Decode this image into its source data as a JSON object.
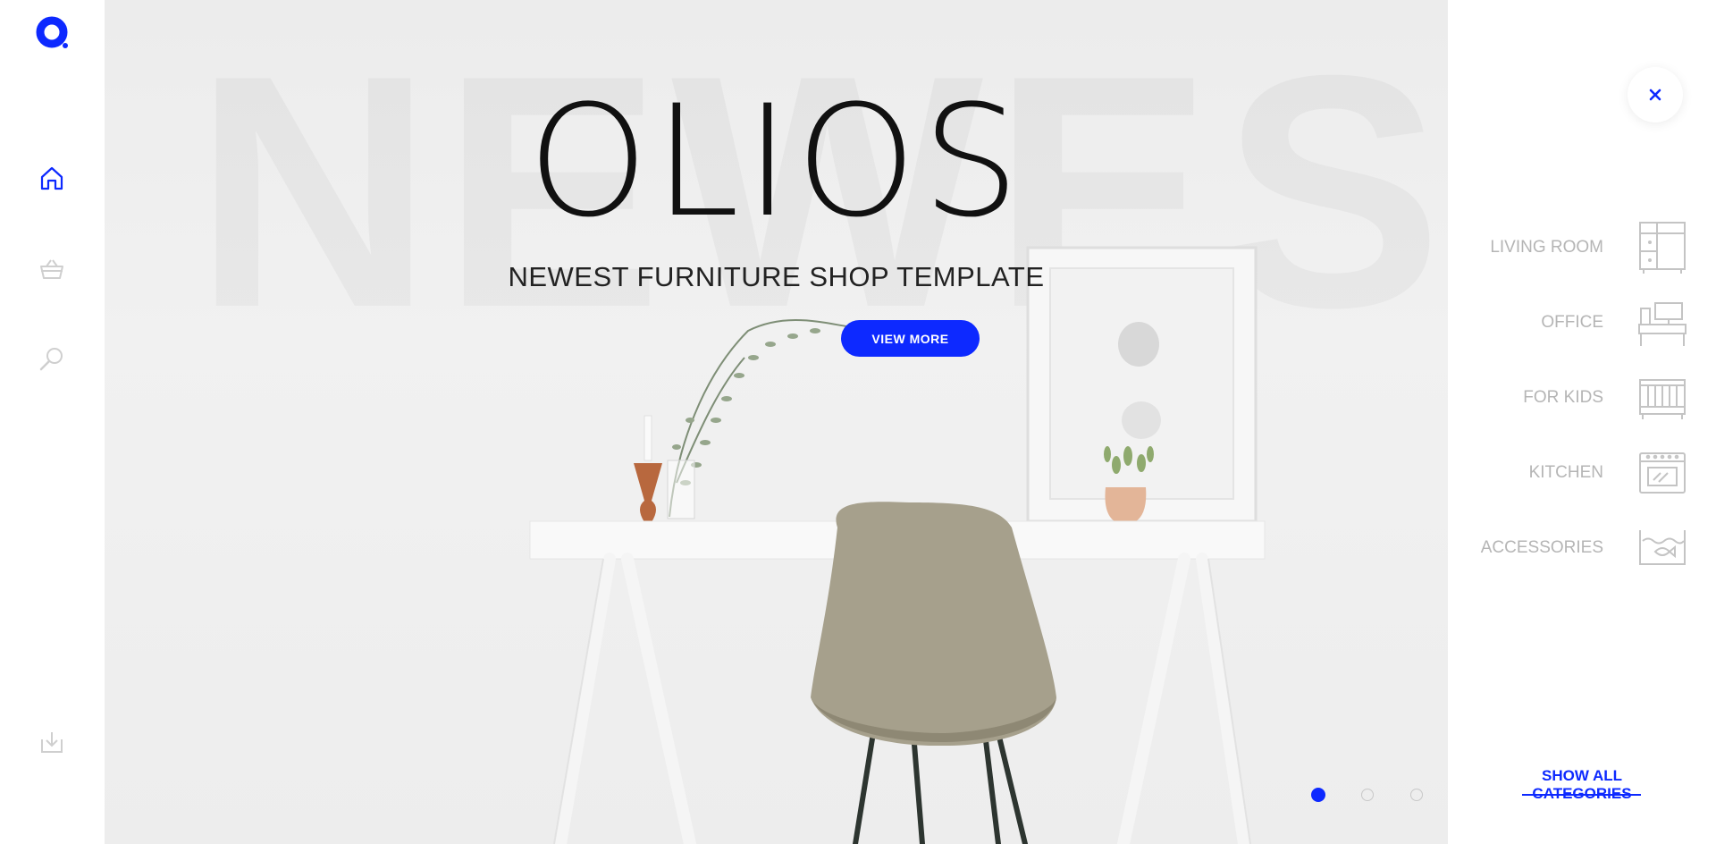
{
  "brand": {
    "logo_icon": "olios-logo-icon",
    "accent": "#0d29ff"
  },
  "sidebar": {
    "items": [
      {
        "name": "home",
        "icon": "home-icon",
        "active": true
      },
      {
        "name": "basket",
        "icon": "basket-icon",
        "active": false
      },
      {
        "name": "search",
        "icon": "search-icon",
        "active": false
      },
      {
        "name": "download",
        "icon": "download-icon",
        "active": false
      }
    ]
  },
  "hero": {
    "background_word": "NEWEST",
    "title": "OLIOS",
    "subtitle": "NEWEST FURNITURE SHOP TEMPLATE",
    "cta_label": "VIEW MORE",
    "slides": [
      {
        "active": true
      },
      {
        "active": false
      },
      {
        "active": false
      }
    ]
  },
  "categories": {
    "items": [
      {
        "label": "LIVING ROOM",
        "icon": "wardrobe-icon"
      },
      {
        "label": "OFFICE",
        "icon": "desk-computer-icon"
      },
      {
        "label": "FOR KIDS",
        "icon": "crib-icon"
      },
      {
        "label": "KITCHEN",
        "icon": "oven-icon"
      },
      {
        "label": "ACCESSORIES",
        "icon": "aquarium-icon"
      }
    ],
    "show_all_label": "SHOW ALL CATEGORIES",
    "close_icon": "close-icon"
  }
}
